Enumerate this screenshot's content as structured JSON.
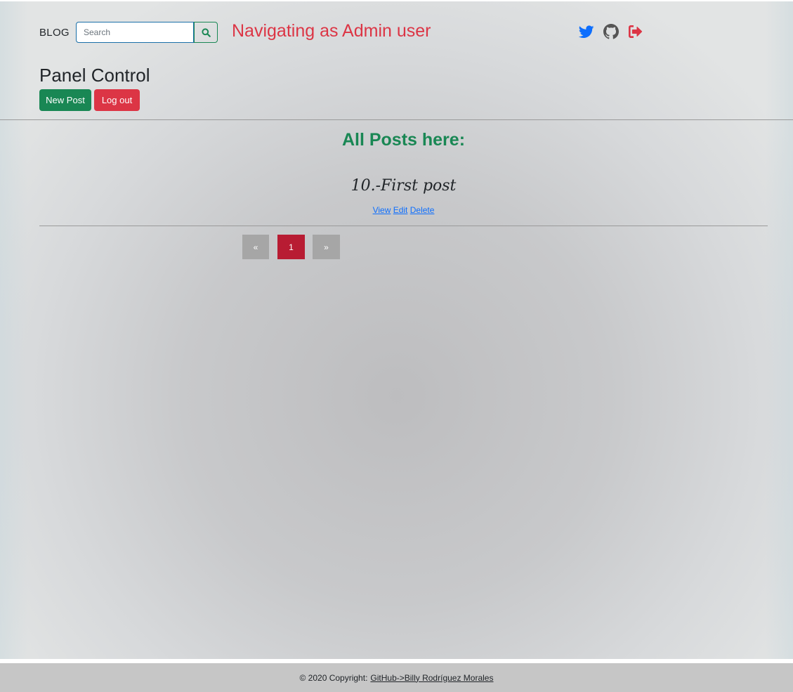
{
  "navbar": {
    "brand": "BLOG",
    "search_placeholder": "Search",
    "search_value": "",
    "admin_note": "Navigating as Admin user",
    "icons": [
      "twitter-icon",
      "github-icon",
      "logout-icon"
    ]
  },
  "panel": {
    "title": "Panel Control",
    "new_post_label": "New Post",
    "logout_label": "Log out"
  },
  "posts": {
    "heading": "All Posts here:",
    "items": [
      {
        "title": "10.-First post",
        "view_label": "View",
        "edit_label": "Edit",
        "delete_label": "Delete"
      }
    ]
  },
  "pagination": {
    "prev": "«",
    "pages": [
      "1"
    ],
    "next": "»"
  },
  "footer": {
    "prefix": "© 2020 Copyright:",
    "link": "GitHub->Billy Rodríguez Morales"
  },
  "colors": {
    "success": "#198754",
    "danger": "#dc3545",
    "twitter": "#0d6efd",
    "github": "#555555",
    "active_page": "#b81c33"
  }
}
